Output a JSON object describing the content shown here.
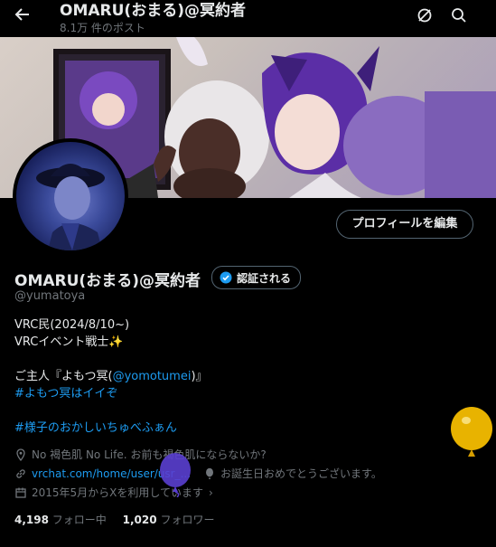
{
  "header": {
    "title": "OMARU(おまる)@冥約者",
    "subtitle": "8.1万 件のポスト"
  },
  "profile": {
    "edit_button": "プロフィールを編集",
    "name": "OMARU(おまる)@冥約者",
    "verified_label": "認証される",
    "handle": "@yumatoya"
  },
  "bio": {
    "line1": "VRC民(2024/8/10~)",
    "line2": "VRCイベント戦士✨",
    "line3_prefix": "ご主人『よもつ冥(",
    "line3_mention": "@yomotumei",
    "line3_suffix": ")』",
    "hashtag1": "#よもつ冥はイイぞ",
    "hashtag2": "#様子のおかしいちゅべふぁん"
  },
  "meta": {
    "location": "No 褐色肌 No Life. お前も褐色肌にならないか?",
    "website": "vrchat.com/home/user/usr_...",
    "birthday": "お誕生日おめでとうございます。",
    "joined": "2015年5月からXを利用しています"
  },
  "stats": {
    "following_count": "4,198",
    "following_label": "フォロー中",
    "followers_count": "1,020",
    "followers_label": "フォロワー"
  },
  "colors": {
    "background": "#000000",
    "text": "#e7e9ea",
    "muted": "#71767b",
    "link": "#1d9bf0",
    "border": "#536471"
  }
}
